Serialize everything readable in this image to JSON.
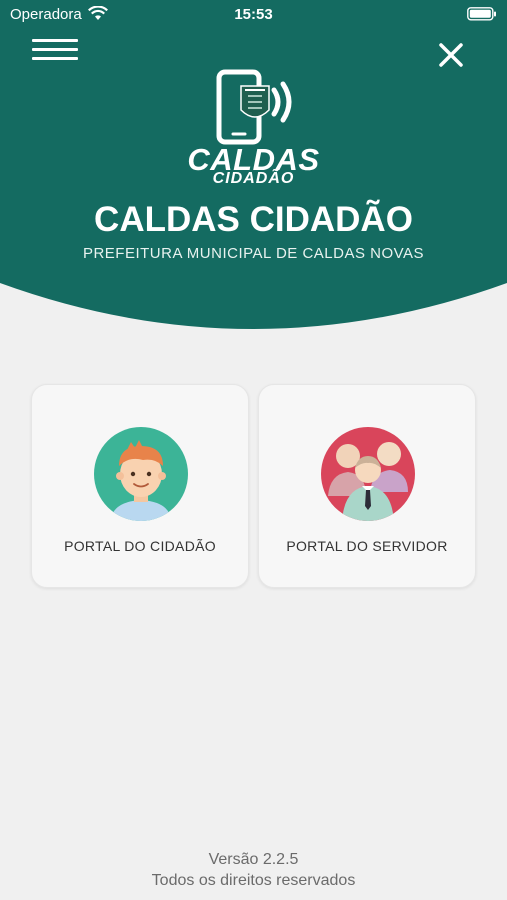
{
  "colors": {
    "header": "#146b61",
    "background": "#f0f0f0",
    "cidadao_circle": "#3cb497",
    "servidor_circle": "#d9455b"
  },
  "status_bar": {
    "carrier": "Operadora",
    "time": "15:53",
    "icons": [
      "wifi-icon",
      "battery-icon"
    ]
  },
  "header": {
    "menu_icon": "hamburger-menu-icon",
    "close_icon": "close-icon",
    "logo_word_big": "CALDAS",
    "logo_word_small": "CIDADÃO",
    "title": "CALDAS CIDADÃO",
    "subtitle": "PREFEITURA MUNICIPAL DE CALDAS NOVAS"
  },
  "portals": [
    {
      "label": "PORTAL DO CIDADÃO",
      "icon": "citizen-avatar-icon"
    },
    {
      "label": "PORTAL DO SERVIDOR",
      "icon": "servants-group-icon"
    }
  ],
  "footer": {
    "version": "Versão 2.2.5",
    "rights": "Todos os direitos reservados"
  }
}
